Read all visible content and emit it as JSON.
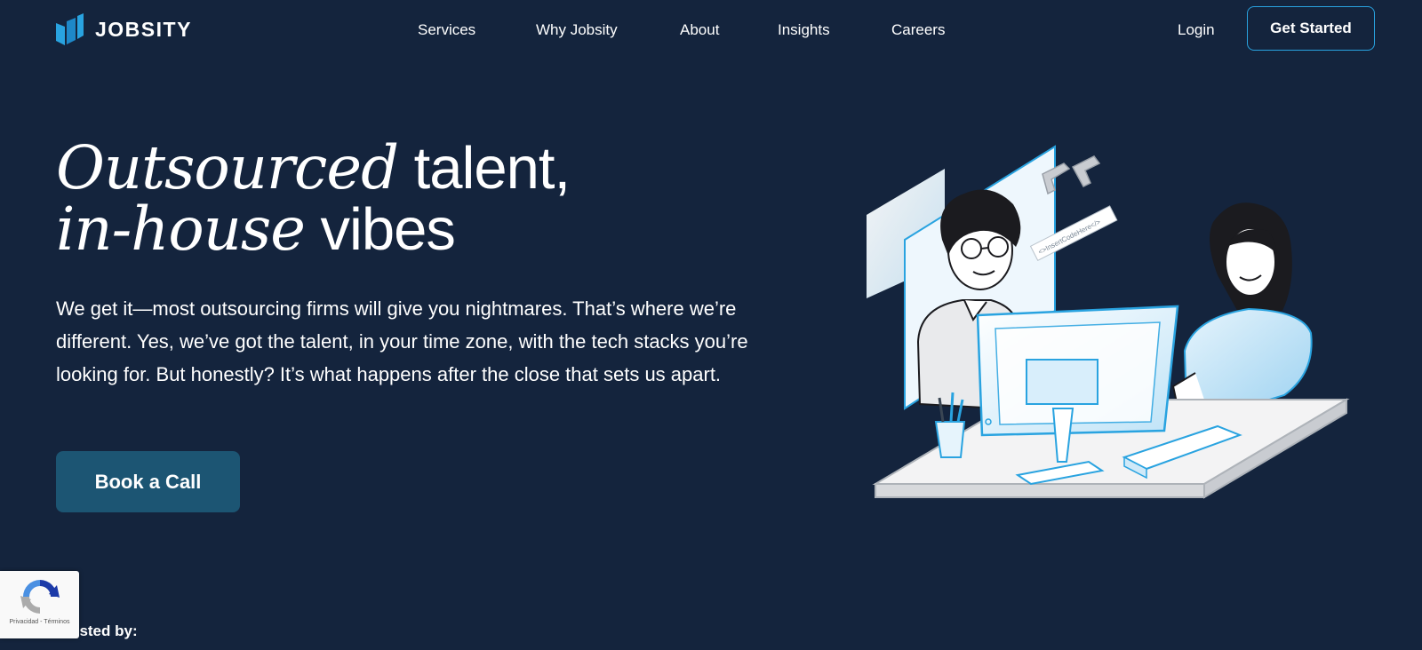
{
  "header": {
    "logo_text": "JOBSITY",
    "nav": [
      {
        "label": "Services"
      },
      {
        "label": "Why Jobsity"
      },
      {
        "label": "About"
      },
      {
        "label": "Insights"
      },
      {
        "label": "Careers"
      }
    ],
    "login_label": "Login",
    "get_started_label": "Get Started"
  },
  "hero": {
    "title_line1_italic": "Outsourced",
    "title_line1_rest": " talent,",
    "title_line2_italic": "in-house",
    "title_line2_rest": " vibes",
    "description": "We get it—most outsourcing firms will give you nightmares. That’s where we’re different. Yes, we’ve got the talent, in your time zone, with the tech stacks you’re looking for. But honestly? It’s what happens after the close that sets us apart.",
    "cta_label": "Book a Call"
  },
  "illustration": {
    "code_tag_text": "<>InsertCodeHere</>"
  },
  "trusted_label": "Trusted by:",
  "recaptcha": {
    "footer": "Privacidad - Términos"
  },
  "colors": {
    "background": "#14243d",
    "accent_blue": "#29a3e0",
    "cta_background": "#1c5573"
  }
}
